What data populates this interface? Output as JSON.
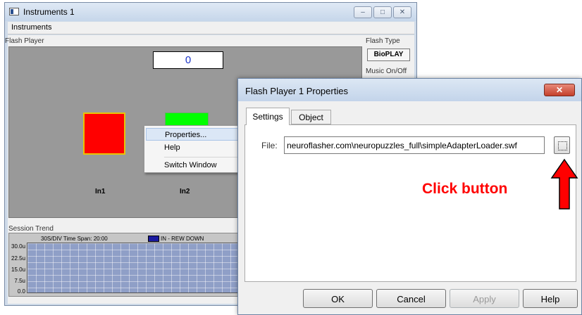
{
  "window": {
    "title": "Instruments 1",
    "controls": {
      "minimize": "‒",
      "maximize": "□",
      "close": "✕"
    },
    "menu": [
      "Instruments"
    ]
  },
  "flash_player": {
    "label": "Flash Player",
    "counter": "0",
    "labels": [
      "In1",
      "In2"
    ],
    "colors": {
      "left_square": "#ff0000",
      "right_square": "#00ff00",
      "background": "#999999"
    }
  },
  "side_panel": {
    "flash_type_label": "Flash Type",
    "flash_type_value": "BioPLAY",
    "music_label": "Music On/Off"
  },
  "context_menu": {
    "items": [
      "Properties...",
      "Help",
      "Switch Window"
    ]
  },
  "session_trend": {
    "label": "Session Trend",
    "header": "30S/DIV   Time Span: 20:00",
    "legend": "IN - REW DOWN",
    "y_ticks": [
      "30.0u",
      "22.5u",
      "15.0u",
      "7.5u",
      "0.0"
    ]
  },
  "dialog": {
    "title": "Flash Player 1 Properties",
    "close_icon": "close-icon",
    "tabs": [
      "Settings",
      "Object"
    ],
    "file_label": "File:",
    "file_value": "neuroflasher.com\\neuropuzzles_full\\simpleAdapterLoader.swf",
    "buttons": {
      "ok": "OK",
      "cancel": "Cancel",
      "apply": "Apply",
      "help": "Help"
    }
  },
  "annotation": {
    "text": "Click button",
    "color": "#ff0000"
  }
}
